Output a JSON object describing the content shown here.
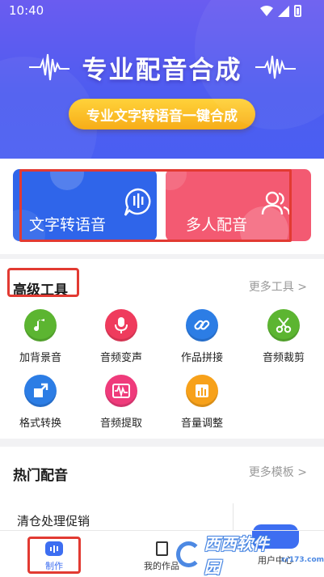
{
  "status_bar": {
    "time": "10:40"
  },
  "hero": {
    "title": "专业配音合成",
    "subtitle_button": "专业文字转语音一键合成"
  },
  "feature_cards": [
    {
      "label": "文字转语音",
      "icon": "speech-bubble-mic-icon",
      "color": "#2f65ea"
    },
    {
      "label": "多人配音",
      "icon": "people-icon",
      "color": "#f35a72"
    }
  ],
  "tools_section": {
    "title": "高级工具",
    "more": "更多工具 >",
    "items": [
      {
        "label": "加背景音",
        "icon": "music-note-icon",
        "color": "#5cb531"
      },
      {
        "label": "音频变声",
        "icon": "microphone-icon",
        "color": "#ef3b5d"
      },
      {
        "label": "作品拼接",
        "icon": "link-icon",
        "color": "#2c7de5"
      },
      {
        "label": "音频裁剪",
        "icon": "scissors-icon",
        "color": "#5cb531"
      },
      {
        "label": "格式转换",
        "icon": "convert-arrow-icon",
        "color": "#2c7de5"
      },
      {
        "label": "音频提取",
        "icon": "waveform-icon",
        "color": "#ef3b7b"
      },
      {
        "label": "音量调整",
        "icon": "volume-bars-icon",
        "color": "#f7a11a"
      }
    ]
  },
  "hot_section": {
    "title": "热门配音",
    "more": "更多模板 >",
    "first_item": "清仓处理促销"
  },
  "bottom_nav": [
    {
      "label": "制作",
      "active": true
    },
    {
      "label": "我的作品",
      "active": false
    },
    {
      "label": "用户中心",
      "active": false
    }
  ],
  "watermark": {
    "text": "西西软件园",
    "url": "cr173.com"
  },
  "colors": {
    "accent": "#3d6ef1",
    "highlight": "#e23a32"
  }
}
